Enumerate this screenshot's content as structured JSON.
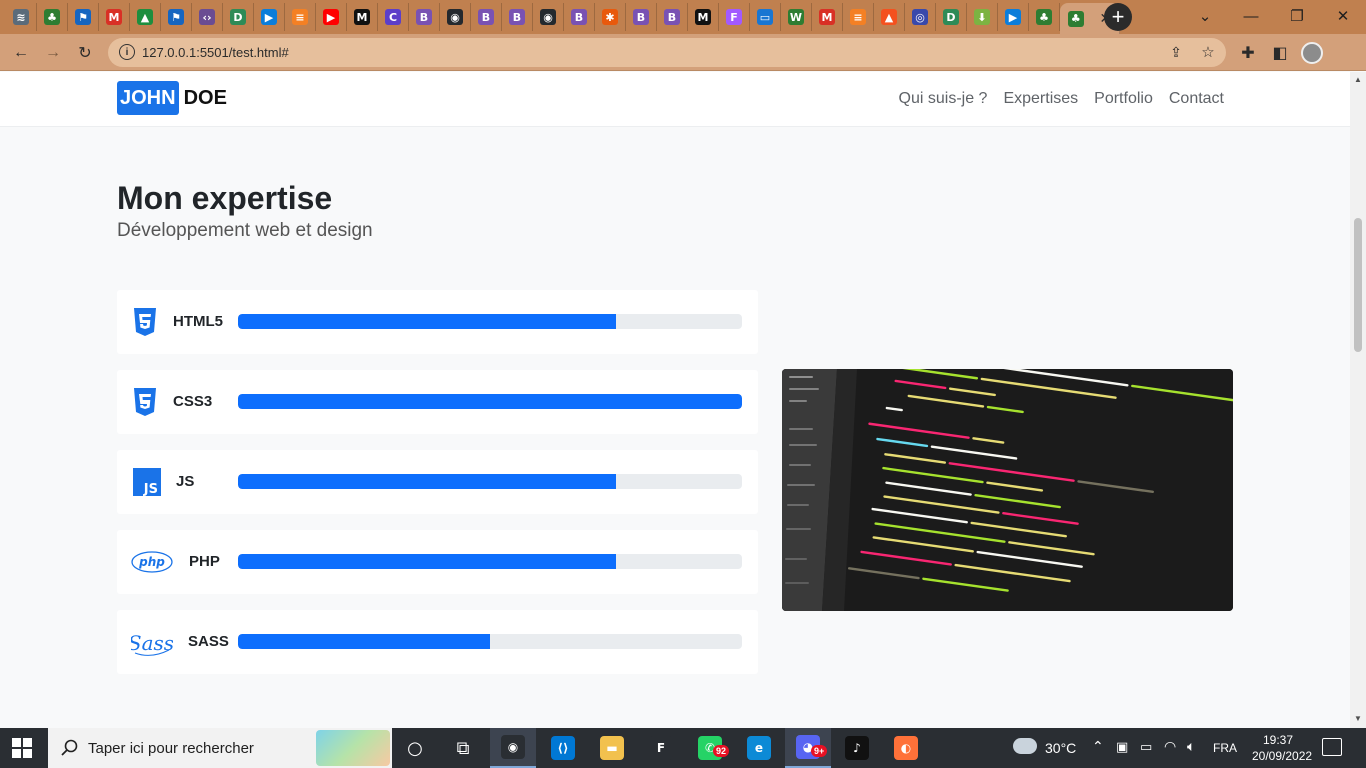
{
  "browser": {
    "tabs": [
      {
        "icon": "stack-icon",
        "color": "#5b6b7a",
        "glyph": "≋"
      },
      {
        "icon": "tree-icon",
        "color": "#2e7d32",
        "glyph": "♣"
      },
      {
        "icon": "flag-icon",
        "color": "#1565c0",
        "glyph": "⚑"
      },
      {
        "icon": "gmail-icon",
        "color": "#d93025",
        "glyph": "M"
      },
      {
        "icon": "drive-icon",
        "color": "#1e8e3e",
        "glyph": "▲"
      },
      {
        "icon": "flag-icon",
        "color": "#1565c0",
        "glyph": "⚑"
      },
      {
        "icon": "code-icon",
        "color": "#6a4c93",
        "glyph": "‹›"
      },
      {
        "icon": "d-icon",
        "color": "#2e8b57",
        "glyph": "D"
      },
      {
        "icon": "play-icon",
        "color": "#0b7dda",
        "glyph": "▶"
      },
      {
        "icon": "stackoverflow-icon",
        "color": "#f48024",
        "glyph": "≡"
      },
      {
        "icon": "youtube-icon",
        "color": "#ff0000",
        "glyph": "▶"
      },
      {
        "icon": "medium-icon",
        "color": "#111111",
        "glyph": "M"
      },
      {
        "icon": "c-icon",
        "color": "#5c3ec9",
        "glyph": "C"
      },
      {
        "icon": "bootstrap-icon",
        "color": "#7952b3",
        "glyph": "B"
      },
      {
        "icon": "github-icon",
        "color": "#24292e",
        "glyph": "◉"
      },
      {
        "icon": "bootstrap-icon",
        "color": "#7952b3",
        "glyph": "B"
      },
      {
        "icon": "bootstrap-icon",
        "color": "#7952b3",
        "glyph": "B"
      },
      {
        "icon": "github-icon",
        "color": "#24292e",
        "glyph": "◉"
      },
      {
        "icon": "bootstrap-icon",
        "color": "#7952b3",
        "glyph": "B"
      },
      {
        "icon": "asterisk-icon",
        "color": "#e8590c",
        "glyph": "✱"
      },
      {
        "icon": "bootstrap-icon",
        "color": "#7952b3",
        "glyph": "B"
      },
      {
        "icon": "bootstrap-icon",
        "color": "#7952b3",
        "glyph": "B"
      },
      {
        "icon": "medium-icon",
        "color": "#111111",
        "glyph": "M"
      },
      {
        "icon": "figma-icon",
        "color": "#a259ff",
        "glyph": "F"
      },
      {
        "icon": "window-icon",
        "color": "#1976d2",
        "glyph": "▭"
      },
      {
        "icon": "w-icon",
        "color": "#2e7d32",
        "glyph": "W"
      },
      {
        "icon": "gmail-icon",
        "color": "#d93025",
        "glyph": "M"
      },
      {
        "icon": "stackoverflow-icon",
        "color": "#f48024",
        "glyph": "≡"
      },
      {
        "icon": "fire-icon",
        "color": "#f4511e",
        "glyph": "▲"
      },
      {
        "icon": "target-icon",
        "color": "#3949ab",
        "glyph": "◎"
      },
      {
        "icon": "d-icon",
        "color": "#2e8b57",
        "glyph": "D"
      },
      {
        "icon": "download-icon",
        "color": "#7cb342",
        "glyph": "⬇"
      },
      {
        "icon": "play-icon",
        "color": "#0b7dda",
        "glyph": "▶"
      },
      {
        "icon": "tree-icon",
        "color": "#2e7d32",
        "glyph": "♣"
      }
    ],
    "active_tab": {
      "icon": "tree-icon",
      "color": "#2e7d32",
      "glyph": "♣",
      "close": "✕"
    },
    "url": "127.0.0.1:5501/test.html#"
  },
  "page": {
    "brand": {
      "first": "JOHN",
      "last": "DOE"
    },
    "nav": [
      "Qui suis-je ?",
      "Expertises",
      "Portfolio",
      "Contact"
    ],
    "section_title": "Mon expertise",
    "section_subtitle": "Développement web et design",
    "skills": [
      {
        "name": "HTML5",
        "icon": "html5-icon",
        "percent": 75
      },
      {
        "name": "CSS3",
        "icon": "css3-icon",
        "percent": 100
      },
      {
        "name": "JS",
        "icon": "js-icon",
        "percent": 75
      },
      {
        "name": "PHP",
        "icon": "php-icon",
        "percent": 75
      },
      {
        "name": "SASS",
        "icon": "sass-icon",
        "percent": 50
      }
    ],
    "accent_color": "#0d6efd"
  },
  "taskbar": {
    "search_placeholder": "Taper ici pour rechercher",
    "apps": [
      {
        "icon": "cortana-icon",
        "color": "transparent",
        "glyph": "○"
      },
      {
        "icon": "task-view-icon",
        "color": "transparent",
        "glyph": "⧉"
      },
      {
        "icon": "chrome-icon",
        "color": "#2a2e33",
        "glyph": "◉",
        "running": true
      },
      {
        "icon": "vscode-icon",
        "color": "#0078d4",
        "glyph": "⟨⟩"
      },
      {
        "icon": "file-explorer-icon",
        "color": "#f2c14e",
        "glyph": "▬"
      },
      {
        "icon": "figma-icon",
        "color": "#2a2e33",
        "glyph": "F"
      },
      {
        "icon": "whatsapp-icon",
        "color": "#25d366",
        "glyph": "✆",
        "badge": "92"
      },
      {
        "icon": "edge-icon",
        "color": "#0c8ad6",
        "glyph": "e"
      },
      {
        "icon": "discord-icon",
        "color": "#5865f2",
        "glyph": "◕",
        "badge": "9+",
        "running": true
      },
      {
        "icon": "tiktok-icon",
        "color": "#111111",
        "glyph": "♪"
      },
      {
        "icon": "firefox-icon",
        "color": "#ff7139",
        "glyph": "◐"
      }
    ],
    "temperature": "30°C",
    "language": "FRA",
    "time": "19:37",
    "date": "20/09/2022"
  }
}
